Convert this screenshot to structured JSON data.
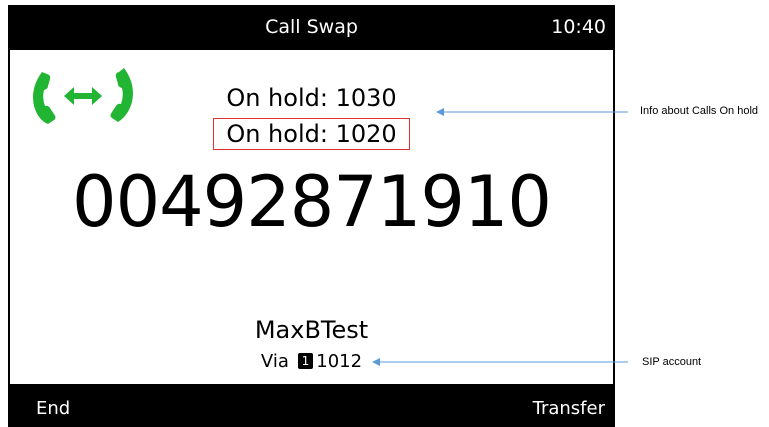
{
  "header": {
    "title": "Call Swap",
    "time": "10:40"
  },
  "icon": {
    "name": "call-swap-icon",
    "color": "#22b534"
  },
  "on_hold": [
    {
      "label": "On hold: 1030"
    },
    {
      "label": "On hold: 1020",
      "highlighted": true,
      "highlight_color": "#e03030"
    }
  ],
  "call": {
    "number": "00492871910",
    "name": "MaxBTest",
    "via_label": "Via",
    "account_index": "1",
    "account": "1012"
  },
  "softkeys": {
    "left": "End",
    "right": "Transfer"
  },
  "annotations": {
    "hold_info": "Info about Calls On hold",
    "sip_account": "SIP account",
    "arrow_color": "#5b9bd5"
  }
}
